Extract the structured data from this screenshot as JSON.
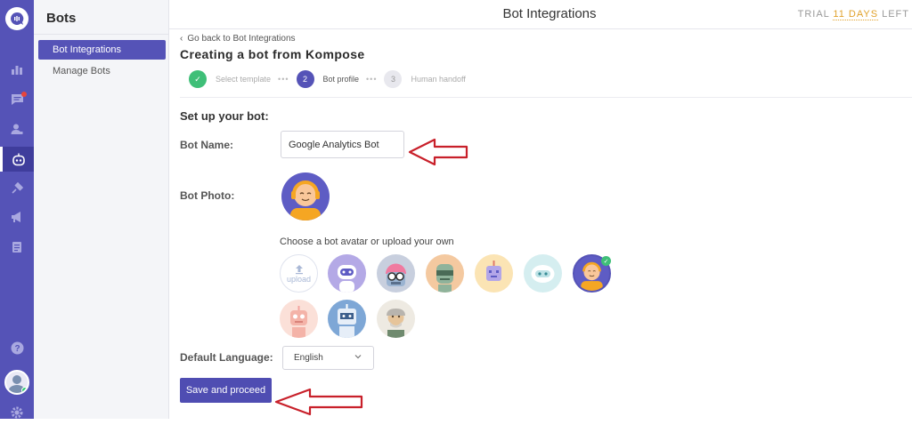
{
  "sidebar": {
    "title": "Bots",
    "items": [
      {
        "label": "Bot Integrations",
        "active": true
      },
      {
        "label": "Manage Bots",
        "active": false
      }
    ]
  },
  "header": {
    "title": "Bot Integrations",
    "trial_prefix": "TRIAL ",
    "trial_days": "11 DAYS",
    "trial_suffix": " LEFT"
  },
  "main": {
    "back_link": "Go back to Bot Integrations",
    "title": "Creating a bot from Kompose",
    "steps": [
      {
        "number": "✓",
        "label": "Select template",
        "state": "done"
      },
      {
        "number": "2",
        "label": "Bot profile",
        "state": "current"
      },
      {
        "number": "3",
        "label": "Human handoff",
        "state": "todo"
      }
    ],
    "section_title": "Set up your bot:",
    "bot_name_label": "Bot Name:",
    "bot_name_value": "Google Analytics Bot",
    "bot_photo_label": "Bot Photo:",
    "choose_avatar_text": "Choose a bot avatar or upload your own",
    "upload_label": "upload",
    "avatars": [
      {
        "name": "avatar-purple-robot",
        "bg": "#b4a9e6"
      },
      {
        "name": "avatar-glasses-bot",
        "bg": "#c8cfde"
      },
      {
        "name": "avatar-visor-bot",
        "bg": "#f4c9a0"
      },
      {
        "name": "avatar-square-bot",
        "bg": "#fbe4b4"
      },
      {
        "name": "avatar-cloud-bot",
        "bg": "#d5eef0"
      },
      {
        "name": "avatar-headset-girl",
        "bg": "#5e5cc4",
        "selected": true
      },
      {
        "name": "avatar-pink-bot",
        "bg": "#fbe0d8"
      },
      {
        "name": "avatar-blue-bot",
        "bg": "#7ea7d6"
      },
      {
        "name": "avatar-old-man",
        "bg": "#eeeae2"
      }
    ],
    "language_label": "Default Language:",
    "language_value": "English",
    "save_button": "Save and proceed"
  },
  "colors": {
    "rail": "#5553b7",
    "accent": "#4f4db2",
    "success": "#3fbf78",
    "trial_highlight": "#e0a12a",
    "annotation_arrow": "#c8202a"
  }
}
